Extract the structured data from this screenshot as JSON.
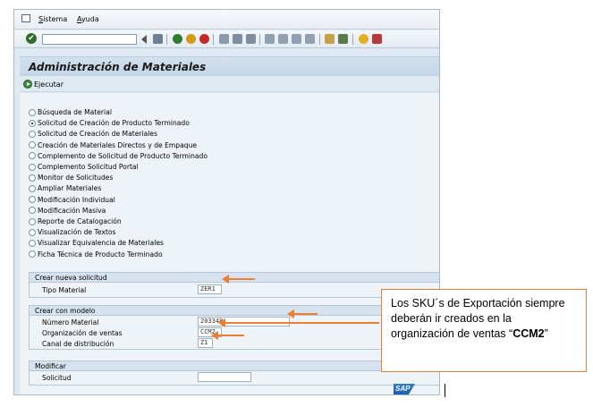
{
  "menu": {
    "items": [
      {
        "label": "Sistema",
        "underline": "S",
        "rest": "istema"
      },
      {
        "label": "Ayuda",
        "underline": "A",
        "rest": "yuda"
      }
    ]
  },
  "toolbar": {
    "command_value": ""
  },
  "title": "Administración de Materiales",
  "app_toolbar": {
    "execute_label": "Ejecutar"
  },
  "options": [
    {
      "label": "Búsqueda de Material",
      "selected": false
    },
    {
      "label": "Solicitud de Creación de Producto Terminado",
      "selected": true
    },
    {
      "label": "Solicitud de Creación de Materiales",
      "selected": false
    },
    {
      "label": "Creación de Materiales Directos y de Empaque",
      "selected": false
    },
    {
      "label": "Complemento de Solicitud de Producto Terminado",
      "selected": false
    },
    {
      "label": "Complemento Solicitud Portal",
      "selected": false
    },
    {
      "label": "Monitor de Solicitudes",
      "selected": false
    },
    {
      "label": "Ampliar Materiales",
      "selected": false
    },
    {
      "label": "Modificación Individual",
      "selected": false
    },
    {
      "label": "Modificación Masiva",
      "selected": false
    },
    {
      "label": "Reporte de Catalogación",
      "selected": false
    },
    {
      "label": "Visualización de Textos",
      "selected": false
    },
    {
      "label": "Visualizar Equivalencia de Materiales",
      "selected": false
    },
    {
      "label": "Ficha Técnica de Producto Terminado",
      "selected": false
    }
  ],
  "group_new": {
    "header": "Crear nueva solicitud",
    "tipo_material_label": "Tipo Material",
    "tipo_material_value": "ZER1"
  },
  "group_model": {
    "header": "Crear con modelo",
    "numero_material_label": "Número Material",
    "numero_material_value": "203348",
    "org_ventas_label": "Organización de ventas",
    "org_ventas_value": "CCM2",
    "canal_label": "Canal de distribución",
    "canal_value": "Z1"
  },
  "group_modify": {
    "header": "Modificar",
    "solicitud_label": "Solicitud",
    "solicitud_value": ""
  },
  "callout": {
    "text_before": "Los SKU´s de Exportación siempre deberán ir creados en la organización de ventas “",
    "highlight": "CCM2",
    "text_after": "”"
  },
  "logo_text": "SAP",
  "colors": {
    "accent_orange": "#ed7d31",
    "title_bg": "#c3d5e6",
    "panel_bg": "#eef3f8"
  }
}
